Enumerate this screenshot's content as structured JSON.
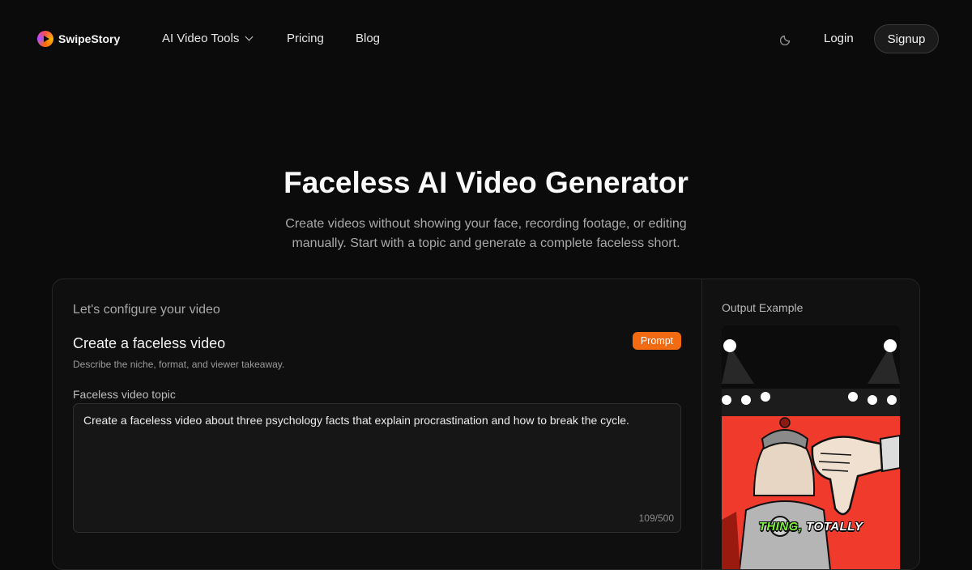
{
  "brand": {
    "name": "SwipeStory"
  },
  "nav": {
    "items": [
      {
        "label": "AI Video Tools"
      },
      {
        "label": "Pricing"
      },
      {
        "label": "Blog"
      }
    ],
    "login_label": "Login",
    "signup_label": "Signup"
  },
  "hero": {
    "title": "Faceless AI Video Generator",
    "subtitle": "Create videos without showing your face, recording footage, or editing manually. Start with a topic and generate a complete faceless short."
  },
  "config": {
    "heading": "Let's configure your video",
    "section_title": "Create a faceless video",
    "section_desc": "Describe the niche, format, and viewer takeaway.",
    "badge": "Prompt",
    "topic_label": "Faceless video topic",
    "topic_value": "Create a faceless video about three psychology facts that explain procrastination and how to break the cycle.",
    "char_count": "109/500"
  },
  "output": {
    "label": "Output Example",
    "caption_word_1": "THING,",
    "caption_word_2": "TOTALLY"
  },
  "colors": {
    "background": "#0b0b0b",
    "accent": "#f26a12",
    "caption_green": "#7cf23a",
    "preview_red": "#ef3a2c"
  }
}
